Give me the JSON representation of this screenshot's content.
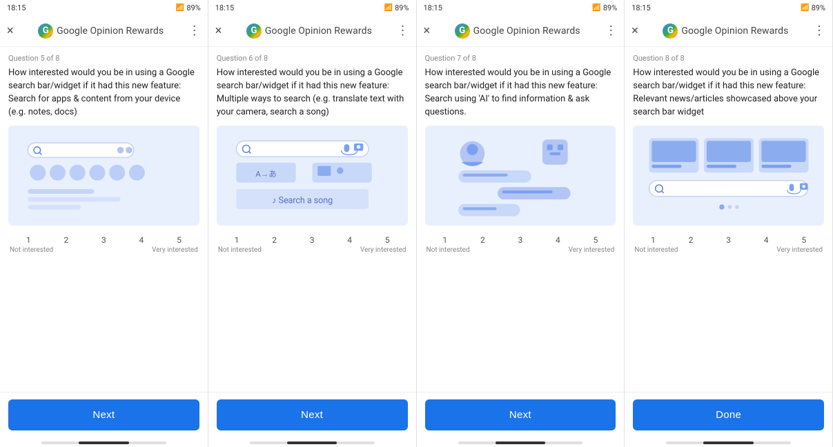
{
  "panels": [
    {
      "id": "panel1",
      "status_time": "18:15",
      "status_battery": "89%",
      "app_title": "Google Opinion Rewards",
      "close_icon": "×",
      "menu_icon": "⋮",
      "question_label": "Question 5 of 8",
      "question_text": "How interested would you be in using a Google search bar/widget if it had this new feature: Search for apps &amp; content from your device (e.g. notes, docs)",
      "scale_numbers": [
        "1",
        "2",
        "3",
        "4",
        "5"
      ],
      "scale_left": "Not interested",
      "scale_right": "Very interested",
      "button_label": "Next",
      "illustration_type": "search-device"
    },
    {
      "id": "panel2",
      "status_time": "18:15",
      "status_battery": "89%",
      "app_title": "Google Opinion Rewards",
      "close_icon": "×",
      "menu_icon": "⋮",
      "question_label": "Question 6 of 8",
      "question_text": "How interested would you be in using a Google search bar/widget if it had this new feature: Multiple ways to search (e.g. translate text with your camera, search a song)",
      "scale_numbers": [
        "1",
        "2",
        "3",
        "4",
        "5"
      ],
      "scale_left": "Not interested",
      "scale_right": "Very interested",
      "button_label": "Next",
      "illustration_type": "search-multi"
    },
    {
      "id": "panel3",
      "status_time": "18:15",
      "status_battery": "89%",
      "app_title": "Google Opinion Rewards",
      "close_icon": "×",
      "menu_icon": "⋮",
      "question_label": "Question 7 of 8",
      "question_text": "How interested would you be in using a Google search bar/widget if it had this new feature: Search using 'AI' to find information &amp; ask questions.",
      "scale_numbers": [
        "1",
        "2",
        "3",
        "4",
        "5"
      ],
      "scale_left": "Not interested",
      "scale_right": "Very interested",
      "button_label": "Next",
      "illustration_type": "search-ai"
    },
    {
      "id": "panel4",
      "status_time": "18:15",
      "status_battery": "89%",
      "app_title": "Google Opinion Rewards",
      "close_icon": "×",
      "menu_icon": "⋮",
      "question_label": "Question 8 of 8",
      "question_text": "How interested would you be in using a Google search bar/widget if it had this new feature: Relevant news/articles showcased above your search bar widget",
      "scale_numbers": [
        "1",
        "2",
        "3",
        "4",
        "5"
      ],
      "scale_left": "Not interested",
      "scale_right": "Very interested",
      "button_label": "Done",
      "illustration_type": "search-news"
    }
  ]
}
